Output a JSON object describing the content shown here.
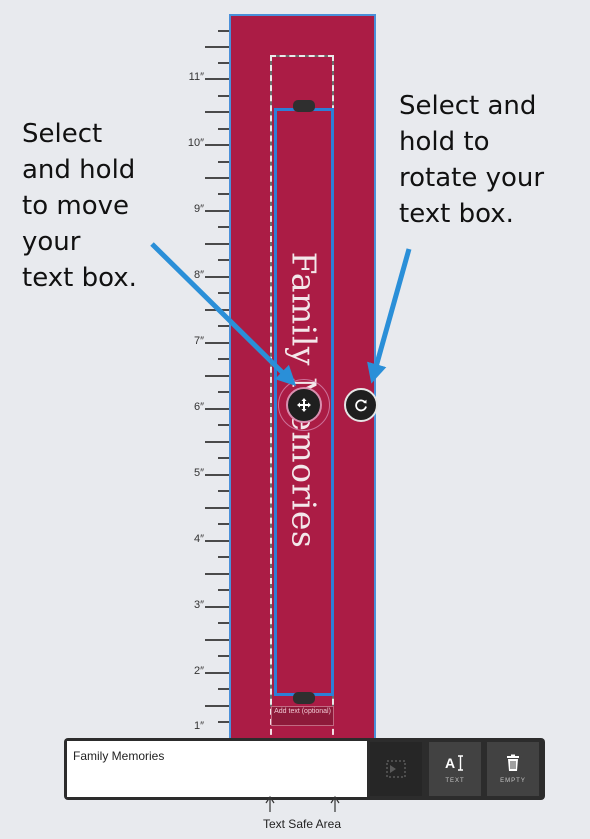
{
  "ruler": {
    "labels": [
      "11″",
      "10″",
      "9″",
      "8″",
      "7″",
      "6″",
      "5″",
      "4″",
      "3″",
      "2″",
      "1″"
    ]
  },
  "design": {
    "text": "Family Memories",
    "add_text_label": "Add text (optional)",
    "strip_color": "#ab1c45",
    "selection_color": "#2d7fd6"
  },
  "instructions": {
    "move_lines": [
      "Select",
      "and hold",
      "to move",
      "your",
      "text box."
    ],
    "rotate_lines": [
      "Select and",
      "hold to",
      "rotate your",
      "text box."
    ]
  },
  "toolbar": {
    "input_value": "Family Memories",
    "text_button_label": "TEXT",
    "empty_button_label": "EMPTY"
  },
  "footer": {
    "safe_area_caption": "Text Safe Area"
  },
  "icons": {
    "move": "move-arrows-icon",
    "rotate": "rotate-icon",
    "alignment": "alignment-icon",
    "text": "text-cursor-icon",
    "empty": "trash-icon"
  }
}
